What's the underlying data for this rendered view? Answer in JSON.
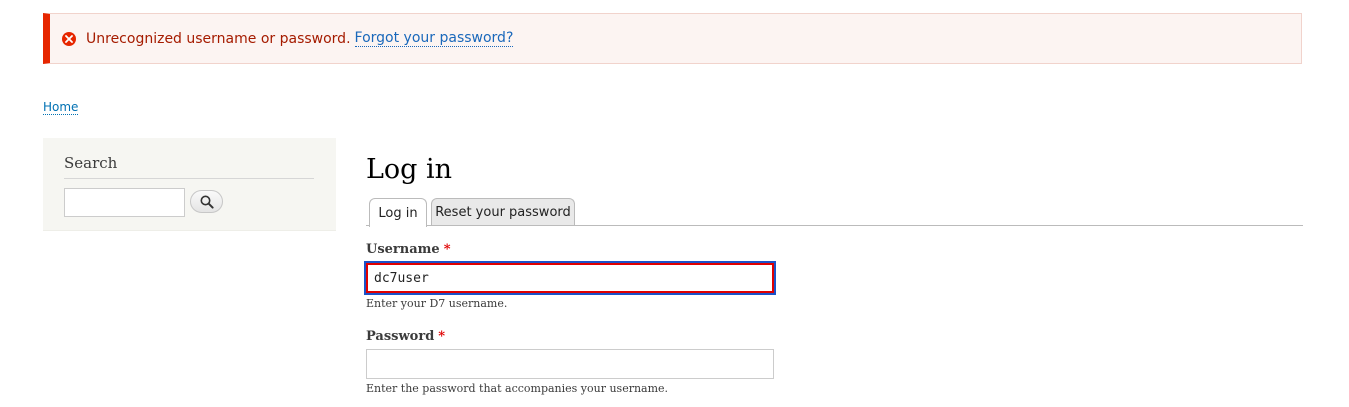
{
  "messages": {
    "error_text": "Unrecognized username or password.",
    "forgot_link": "Forgot your password?"
  },
  "breadcrumb": {
    "home": "Home"
  },
  "sidebar": {
    "search_title": "Search",
    "search_value": ""
  },
  "main": {
    "title": "Log in",
    "tabs": [
      {
        "label": "Log in",
        "active": true
      },
      {
        "label": "Reset your password",
        "active": false
      }
    ],
    "username": {
      "label": "Username",
      "required_marker": "*",
      "value": "dc7user",
      "description": "Enter your D7 username."
    },
    "password": {
      "label": "Password",
      "required_marker": "*",
      "value": "",
      "description": "Enter the password that accompanies your username."
    }
  },
  "colors": {
    "error_accent": "#e62600",
    "error_text": "#a51b00",
    "link": "#0071b3",
    "required": "#e00000",
    "focus_outline": "#1c52c8"
  },
  "icons": {
    "error": "error-circle-x-icon",
    "search": "search-icon"
  }
}
